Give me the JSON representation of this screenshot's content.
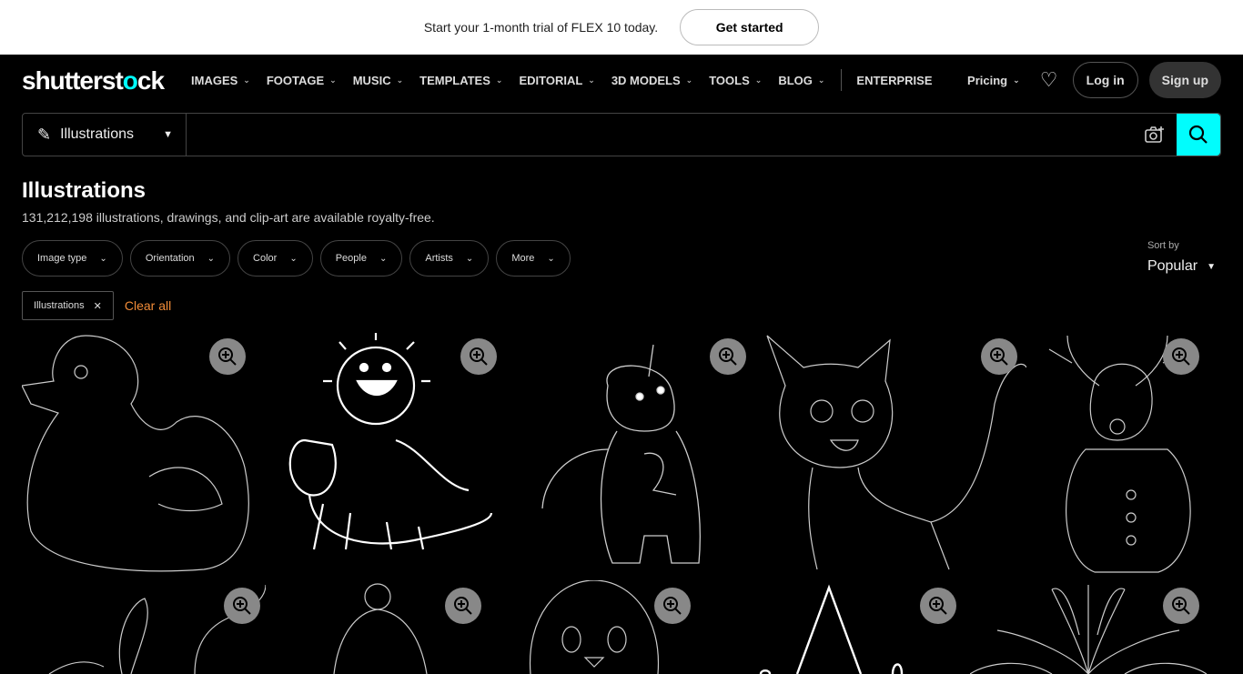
{
  "promo": {
    "text": "Start your 1-month trial of FLEX 10 today.",
    "button": "Get started"
  },
  "nav": {
    "logo": "shutterstock",
    "menu": [
      "IMAGES",
      "FOOTAGE",
      "MUSIC",
      "TEMPLATES",
      "EDITORIAL",
      "3D MODELS",
      "TOOLS",
      "BLOG"
    ],
    "enterprise": "ENTERPRISE",
    "pricing": "Pricing",
    "login": "Log in",
    "signup": "Sign up"
  },
  "search": {
    "type": "Illustrations",
    "value": "",
    "placeholder": ""
  },
  "page": {
    "title": "Illustrations",
    "subtitle": "131,212,198 illustrations, drawings, and clip-art are available royalty-free."
  },
  "filters": [
    "Image type",
    "Orientation",
    "Color",
    "People",
    "Artists",
    "More"
  ],
  "sort": {
    "label": "Sort by",
    "value": "Popular"
  },
  "chips": {
    "active": "Illustrations",
    "clear": "Clear all"
  },
  "colors": {
    "accent": "#01fdfd",
    "clear": "#f28c38"
  },
  "images": [
    "duck-outline",
    "sun-riding-cat",
    "unicorn-number-two",
    "kitten-outline",
    "reindeer-snowman",
    "flower-stem",
    "winter-hat",
    "penguin-face",
    "gnome-hat",
    "daisy-flower"
  ]
}
